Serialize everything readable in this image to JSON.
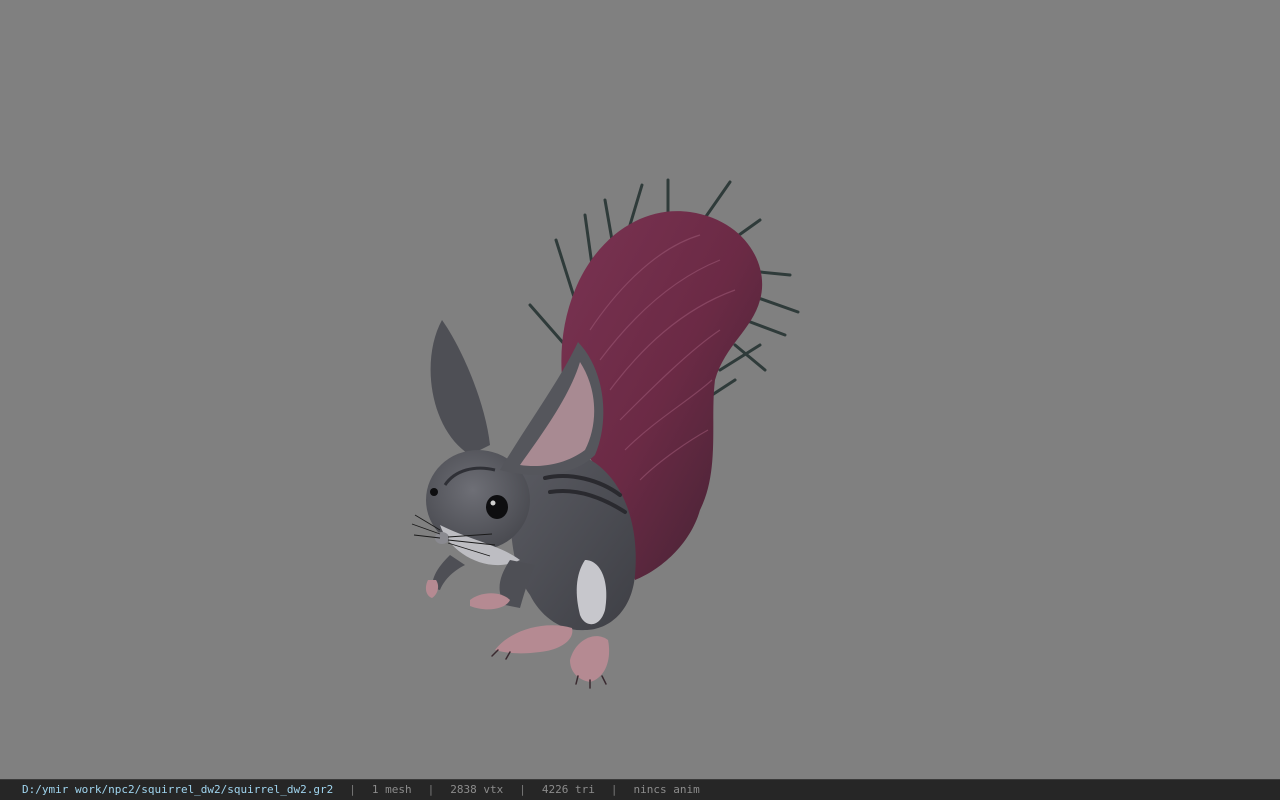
{
  "viewport": {
    "background_color": "#808080",
    "model": {
      "subject": "squirrel",
      "colors": {
        "fur": "#4e4f55",
        "fur_light": "#6a6b72",
        "belly": "#bdbdc2",
        "tail": "#6b2a45",
        "tail_highlight": "#8e4a66",
        "tail_spikes": "#2f3b3a",
        "ear_inner": "#a88a92",
        "paws": "#b58a92",
        "eye": "#0e0e10"
      }
    }
  },
  "status_bar": {
    "path": "D:/ymir work/npc2/squirrel_dw2/squirrel_dw2.gr2",
    "separator": "|",
    "mesh": "1 mesh",
    "vertices": "2838 vtx",
    "triangles": "4226 tri",
    "animation": "nincs anim",
    "colors": {
      "background": "#262626",
      "path": "#9fd4ee",
      "text": "#8c8c8c"
    }
  }
}
